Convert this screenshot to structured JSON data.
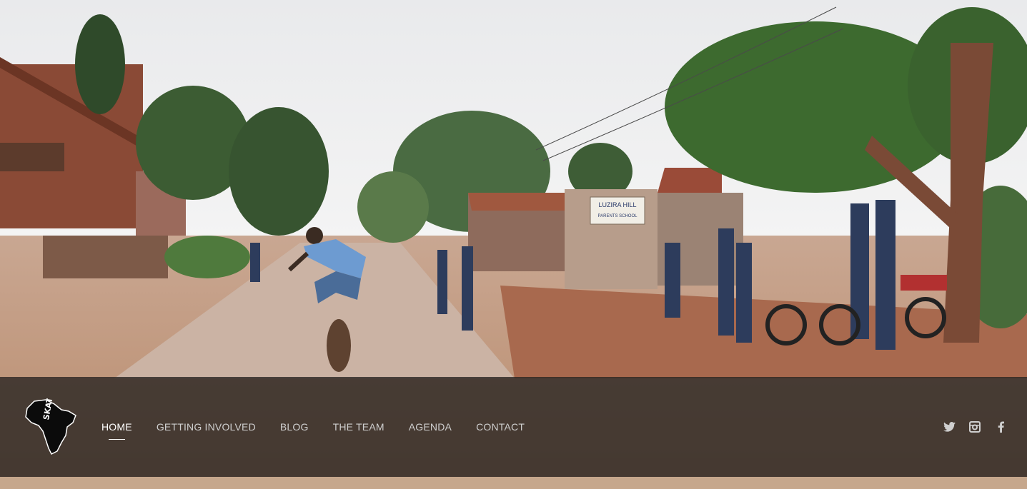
{
  "brand": {
    "logo_text": "SKATE 4",
    "logo_icon": "africa-map-logo-icon"
  },
  "nav": {
    "items": [
      {
        "label": "HOME",
        "active": true
      },
      {
        "label": "GETTING INVOLVED",
        "active": false
      },
      {
        "label": "BLOG",
        "active": false
      },
      {
        "label": "THE TEAM",
        "active": false
      },
      {
        "label": "AGENDA",
        "active": false
      },
      {
        "label": "CONTACT",
        "active": false
      }
    ]
  },
  "social": [
    {
      "name": "twitter-icon"
    },
    {
      "name": "instagram-icon"
    },
    {
      "name": "facebook-icon"
    }
  ],
  "hero": {
    "signs": [
      {
        "text": "LUZIRA HILL"
      },
      {
        "text": "PARENTS SCHOOL"
      }
    ]
  },
  "colors": {
    "nav_bg": "#282422",
    "nav_text": "#cfcfcf",
    "nav_active": "#ffffff"
  }
}
